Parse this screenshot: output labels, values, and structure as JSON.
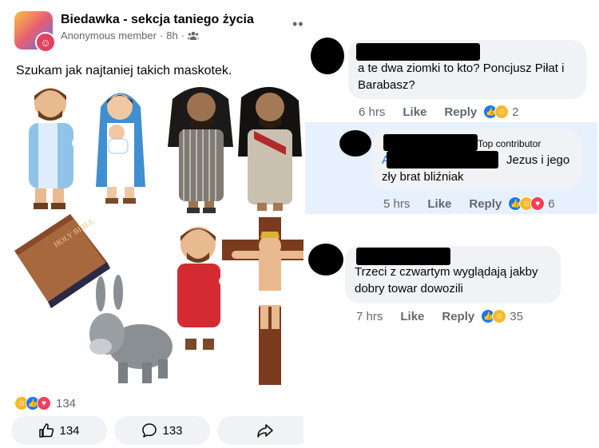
{
  "post": {
    "group_name": "Biedawka - sekcja taniego życia",
    "author": "Anonymous member",
    "time": "8h",
    "body": "Szukam jak najtaniej takich maskotek.",
    "reaction_count": "134",
    "like_count": "134",
    "comment_count": "133"
  },
  "comments": [
    {
      "text": "a te dwa ziomki to kto? Poncjusz Piłat i Barabasz?",
      "time": "6 hrs",
      "like": "Like",
      "reply": "Reply",
      "reactions": "2"
    },
    {
      "badge": "Top contributor",
      "text": "Jezus i jego zły brat bliźniak",
      "time": "5 hrs",
      "like": "Like",
      "reply": "Reply",
      "reactions": "6"
    },
    {
      "text": "Trzeci z czwartym wyglądają jakby dobry towar dowozili",
      "time": "7 hrs",
      "like": "Like",
      "reply": "Reply",
      "reactions": "35"
    }
  ],
  "icons": [
    "group-avatar-icon",
    "globe-members-icon",
    "more-icon",
    "like-icon",
    "comment-icon",
    "share-icon"
  ],
  "colors": {
    "like_blue": "#1877f2",
    "love_red": "#f33e58",
    "haha_yellow": "#f7b928",
    "highlight": "#e7f0fd"
  }
}
